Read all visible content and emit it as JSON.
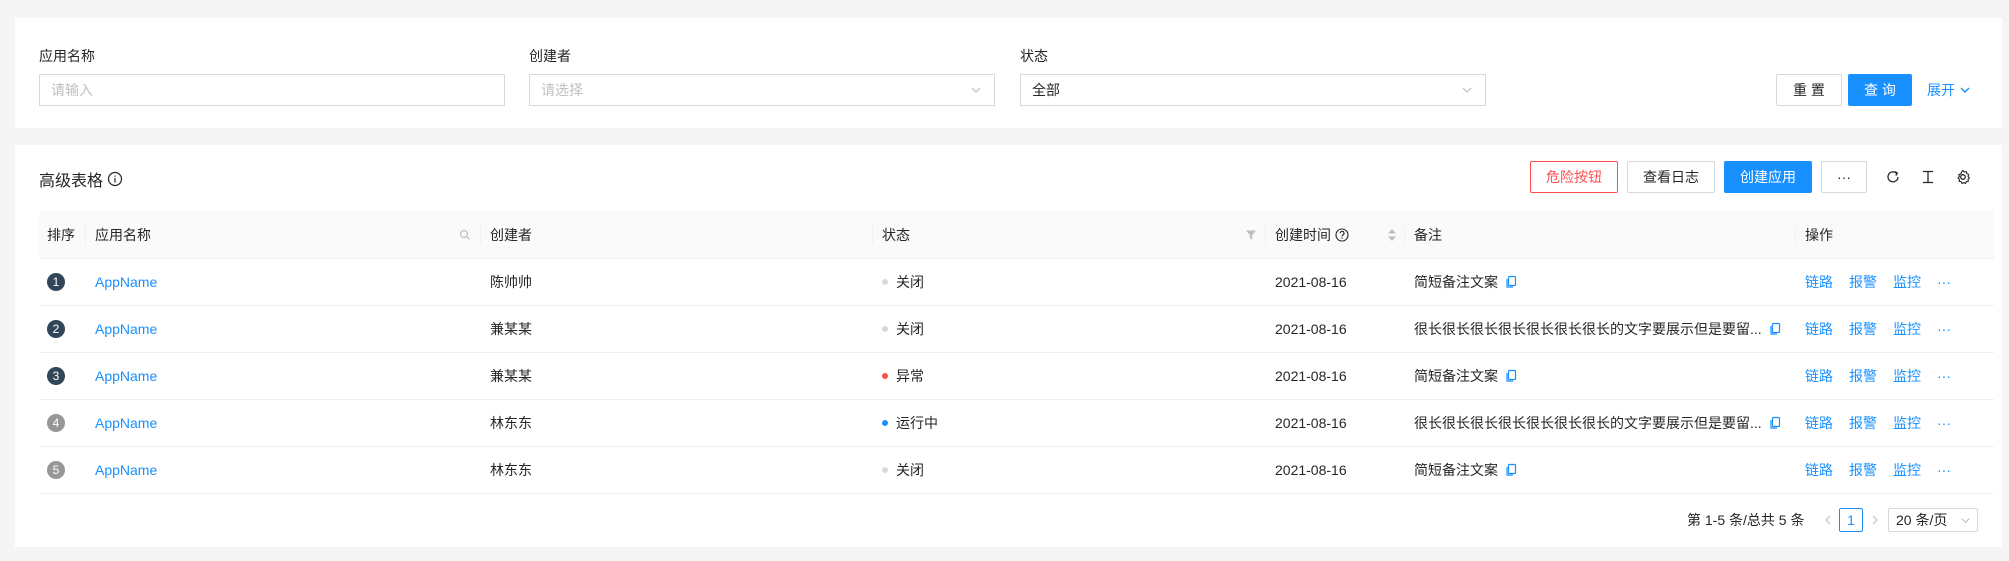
{
  "search": {
    "app_name_label": "应用名称",
    "app_name_placeholder": "请输入",
    "creator_label": "创建者",
    "creator_placeholder": "请选择",
    "status_label": "状态",
    "status_value": "全部",
    "reset_label": "重 置",
    "query_label": "查 询",
    "expand_label": "展开"
  },
  "table": {
    "title": "高级表格",
    "danger_button": "危险按钮",
    "log_button": "查看日志",
    "create_button": "创建应用",
    "more_button": "···",
    "columns": {
      "rank": "排序",
      "app_name": "应用名称",
      "creator": "创建者",
      "status": "状态",
      "created_at": "创建时间",
      "remark": "备注",
      "actions": "操作"
    },
    "rows": [
      {
        "rank": "1",
        "rank_color": "#314659",
        "app_name": "AppName",
        "creator": "陈帅帅",
        "status": "关闭",
        "status_color": "#d9d9d9",
        "created_at": "2021-08-16",
        "remark": "简短备注文案"
      },
      {
        "rank": "2",
        "rank_color": "#314659",
        "app_name": "AppName",
        "creator": "兼某某",
        "status": "关闭",
        "status_color": "#d9d9d9",
        "created_at": "2021-08-16",
        "remark": "很长很长很长很长很长很长很长的文字要展示但是要留..."
      },
      {
        "rank": "3",
        "rank_color": "#314659",
        "app_name": "AppName",
        "creator": "兼某某",
        "status": "异常",
        "status_color": "#ff4d4f",
        "created_at": "2021-08-16",
        "remark": "简短备注文案"
      },
      {
        "rank": "4",
        "rank_color": "#979797",
        "app_name": "AppName",
        "creator": "林东东",
        "status": "运行中",
        "status_color": "#1890ff",
        "created_at": "2021-08-16",
        "remark": "很长很长很长很长很长很长很长的文字要展示但是要留..."
      },
      {
        "rank": "5",
        "rank_color": "#979797",
        "app_name": "AppName",
        "creator": "林东东",
        "status": "关闭",
        "status_color": "#d9d9d9",
        "created_at": "2021-08-16",
        "remark": "简短备注文案"
      }
    ],
    "row_actions": [
      "链路",
      "报警",
      "监控",
      "···"
    ]
  },
  "pagination": {
    "summary": "第 1-5 条/总共 5 条",
    "current_page": "1",
    "page_size": "20 条/页"
  },
  "colors": {
    "primary": "#1890ff",
    "danger": "#ff4d4f"
  },
  "icons": [
    "info-icon",
    "search-icon",
    "filter-icon",
    "question-icon",
    "sort-icon",
    "copy-icon",
    "reload-icon",
    "density-icon",
    "settings-icon",
    "chevron-down-icon",
    "chevron-left-icon",
    "chevron-right-icon"
  ]
}
